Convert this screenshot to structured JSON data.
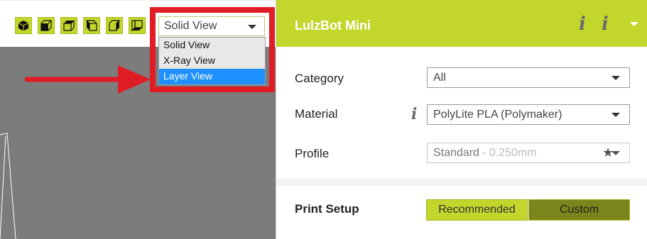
{
  "toolbar": {
    "view_buttons": [
      {
        "name": "3d-view-icon"
      },
      {
        "name": "front-view-icon"
      },
      {
        "name": "top-view-icon"
      },
      {
        "name": "left-view-icon"
      },
      {
        "name": "right-view-icon"
      },
      {
        "name": "bottom-view-icon"
      }
    ],
    "view_select": {
      "value": "Solid View",
      "options": [
        "Solid View",
        "X-Ray View",
        "Layer View"
      ],
      "highlighted": "Layer View"
    }
  },
  "annotation": {
    "arrow_color": "#e01c24",
    "box_color": "#e01c24"
  },
  "panel": {
    "printer_name": "LulzBot Mini",
    "header_info_icons": [
      "i",
      "i"
    ],
    "category": {
      "label": "Category",
      "value": "All"
    },
    "material": {
      "label": "Material",
      "info_icon": "i",
      "value": "PolyLite PLA (Polymaker)"
    },
    "profile": {
      "label": "Profile",
      "value": "Standard",
      "detail": "- 0.250mm"
    },
    "print_setup": {
      "label": "Print Setup",
      "recommended": "Recommended",
      "custom": "Custom"
    }
  },
  "colors": {
    "accent": "#c3d62c",
    "accent_dark": "#7a861b",
    "viewport": "#7c7c7c",
    "dropdown_selected": "#1e90ff"
  }
}
